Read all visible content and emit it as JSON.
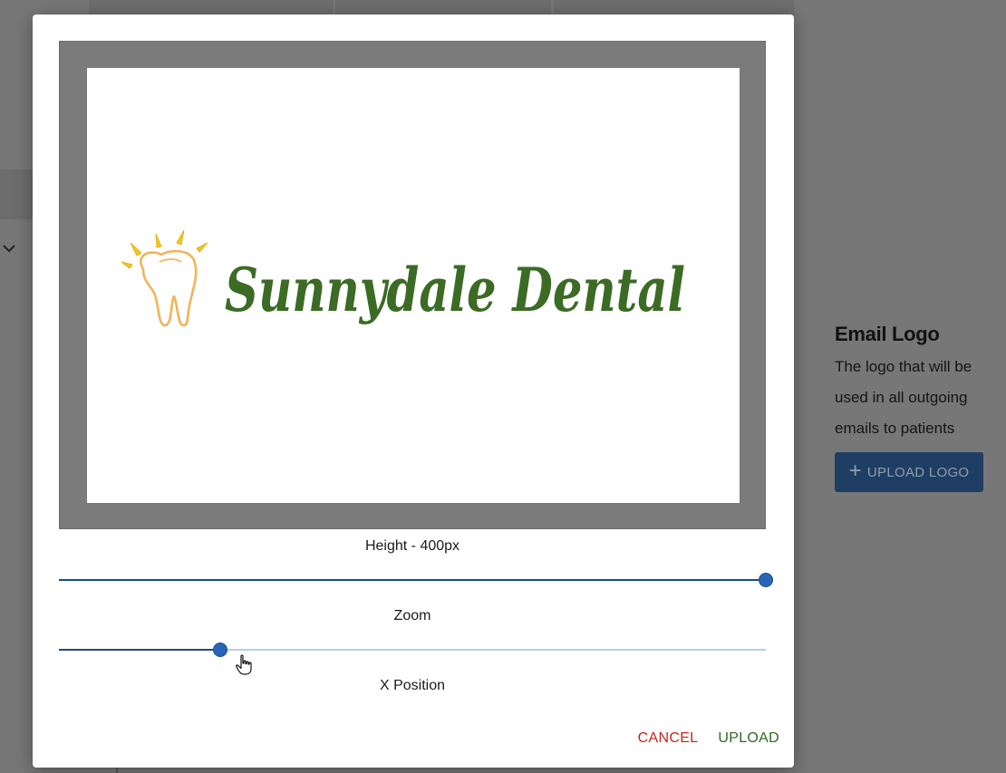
{
  "modal": {
    "logo_image": {
      "text": "Sunnydale Dental"
    },
    "height_slider": {
      "label": "Height - 400px",
      "value_fraction": 1.0
    },
    "zoom_slider": {
      "label": "Zoom",
      "value_fraction": 0.228
    },
    "x_position_slider": {
      "label": "X Position"
    },
    "actions": {
      "cancel": "CANCEL",
      "upload": "UPLOAD"
    }
  },
  "email_logo": {
    "title": "Email Logo",
    "description": "The logo that will be used in all outgoing emails to patients",
    "upload_button": "UPLOAD LOGO"
  },
  "colors": {
    "primary": "#1c4a8a",
    "cancel": "#c2261f",
    "upload": "#2e6a1f",
    "logo_text": "#3b6b24",
    "tooth_outline": "#f0b45a",
    "sparkle": "#f7c51c"
  }
}
